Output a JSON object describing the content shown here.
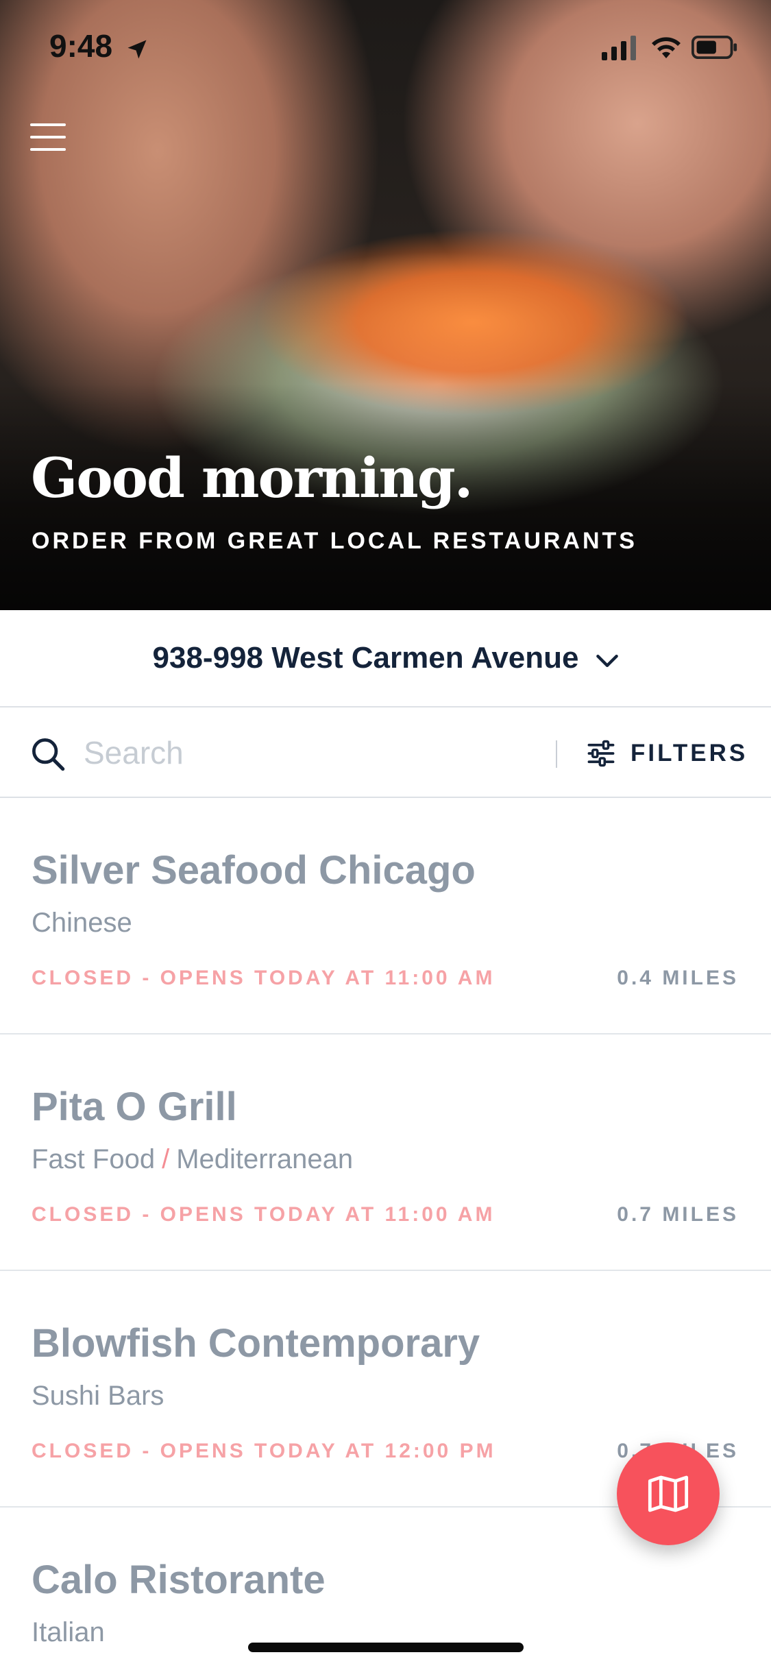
{
  "status_bar": {
    "time": "9:48"
  },
  "hero": {
    "greeting": "Good morning.",
    "subtitle": "ORDER FROM GREAT LOCAL RESTAURANTS"
  },
  "address": {
    "label": "938-998 West Carmen Avenue"
  },
  "search": {
    "placeholder": "Search",
    "value": "",
    "filters_label": "FILTERS"
  },
  "restaurants": [
    {
      "name": "Silver Seafood Chicago",
      "cuisine": [
        "Chinese"
      ],
      "status": "CLOSED - OPENS TODAY AT 11:00 AM",
      "distance": "0.4 MILES"
    },
    {
      "name": "Pita O Grill",
      "cuisine": [
        "Fast Food",
        "Mediterranean"
      ],
      "cuisine_separator": "/",
      "status": "CLOSED - OPENS TODAY AT 11:00 AM",
      "distance": "0.7 MILES"
    },
    {
      "name": "Blowfish Contemporary",
      "cuisine": [
        "Sushi Bars"
      ],
      "status": "CLOSED - OPENS TODAY AT 12:00 PM",
      "distance": "0.7 MILES"
    },
    {
      "name": "Calo Ristorante",
      "cuisine": [
        "Italian"
      ],
      "status": "",
      "distance": ""
    }
  ],
  "icons": {
    "menu": "hamburger-icon",
    "search": "search-icon",
    "filters": "sliders-icon",
    "address": "chevron-down-icon",
    "map": "map-icon",
    "location": "location-arrow-icon"
  },
  "colors": {
    "primary_text": "#14233a",
    "muted_text": "#8d98a5",
    "closed_status": "#f6a2a6",
    "accent": "#f7525c"
  }
}
